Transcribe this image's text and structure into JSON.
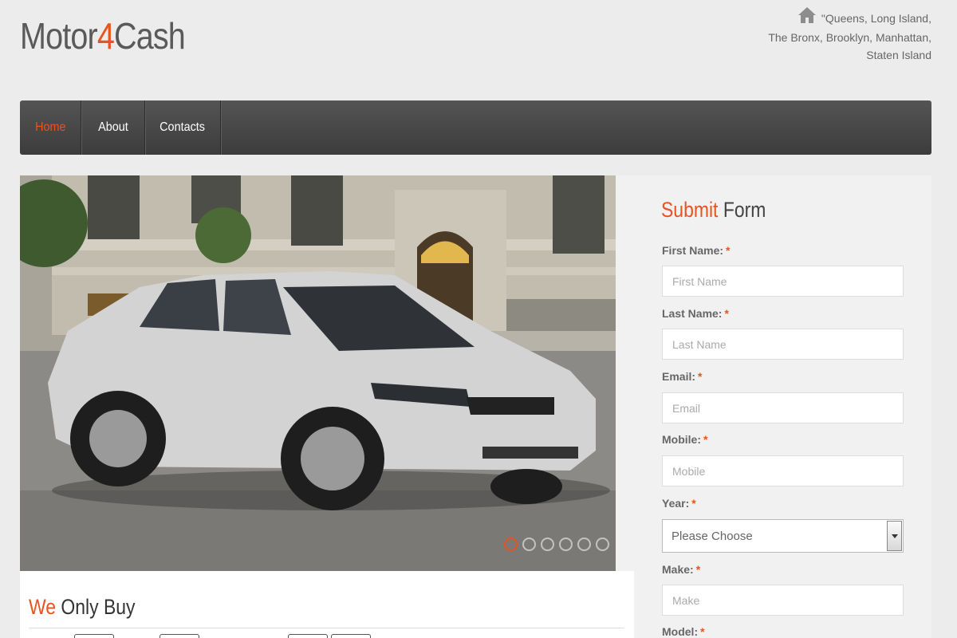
{
  "header": {
    "logo": {
      "part1": "Motor",
      "part2": "4",
      "part3": "Cash"
    },
    "locations": {
      "line1": "\"Queens, Long Island,",
      "line2": "The Bronx, Brooklyn, Manhattan,",
      "line3": "Staten Island"
    },
    "home_icon": "home-icon"
  },
  "nav": {
    "items": [
      {
        "label": "Home",
        "active": true
      },
      {
        "label": "About",
        "active": false
      },
      {
        "label": "Contacts",
        "active": false
      }
    ]
  },
  "slider": {
    "dots_count": 6,
    "active_dot": 1
  },
  "form": {
    "title_accent": "Submit",
    "title_rest": " Form",
    "first_name": {
      "label": "First Name:",
      "required": "*",
      "placeholder": "First Name"
    },
    "last_name": {
      "label": "Last Name:",
      "required": "*",
      "placeholder": "Last Name"
    },
    "email": {
      "label": "Email:",
      "required": "*",
      "placeholder": "Email"
    },
    "mobile": {
      "label": "Mobile:",
      "required": "*",
      "placeholder": "Mobile"
    },
    "year": {
      "label": "Year:",
      "required": "*",
      "selected": "Please Choose"
    },
    "make": {
      "label": "Make:",
      "required": "*",
      "placeholder": "Make"
    },
    "model": {
      "label": "Model:",
      "required": "*"
    }
  },
  "buy": {
    "title_accent": "We",
    "title_rest": " Only Buy"
  },
  "colors": {
    "accent": "#e8531f",
    "nav_bg": "#4a4a4a",
    "page_bg": "#ececec"
  }
}
